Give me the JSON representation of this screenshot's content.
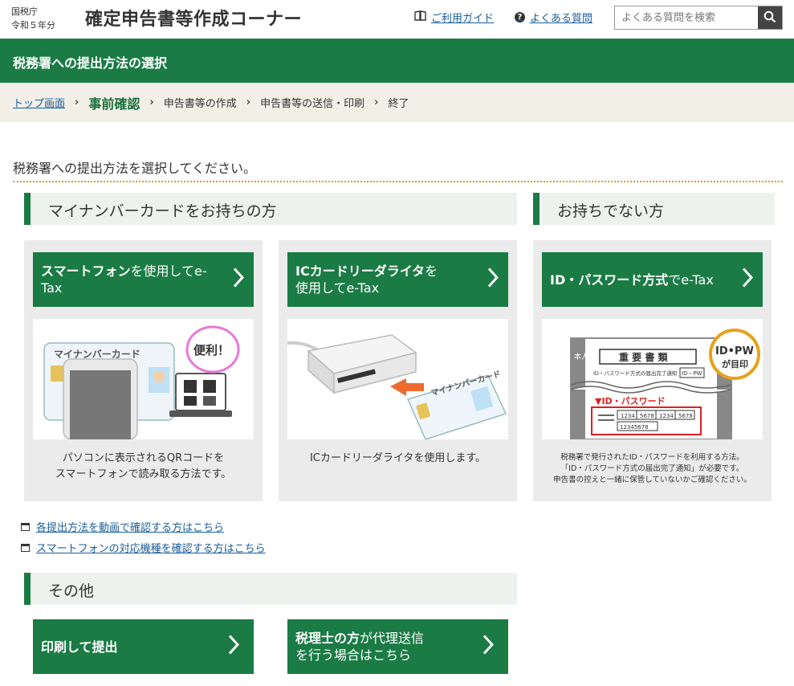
{
  "header": {
    "agency_line1": "国税庁",
    "agency_line2": "令和５年分",
    "title": "確定申告書等作成コーナー",
    "guide_link": "ご利用ガイド",
    "faq_link": "よくある質問",
    "search_placeholder": "よくある質問を検索"
  },
  "band": {
    "title": "税務署への提出方法の選択"
  },
  "breadcrumb": {
    "items": [
      "トップ画面",
      "事前確認",
      "申告書等の作成",
      "申告書等の送信・印刷",
      "終了"
    ],
    "current_index": 1
  },
  "instruction": "税務署への提出方法を選択してください。",
  "sections": {
    "mynumber": "マイナンバーカードをお持ちの方",
    "nocard": "お持ちでない方",
    "other": "その他"
  },
  "cards": [
    {
      "btn_bold": "スマートフォン",
      "btn_rest": "を使用してe-Tax",
      "desc_line1": "パソコンに表示されるQRコードを",
      "desc_line2": "スマートフォンで読み取る方法です。",
      "img_card_text": "マイナンバーカード",
      "img_bubble": "便利！"
    },
    {
      "btn_bold": "ICカードリーダライタ",
      "btn_rest": "を",
      "btn_line2": "使用してe-Tax",
      "desc_line1": "ICカードリーダライタを使用します。",
      "img_card_text": "マイナンバーカード"
    },
    {
      "btn_bold": "ID・パスワード方式",
      "btn_rest": "でe-Tax",
      "desc_line1": "税務署で発行されたID・パスワードを利用する方法。",
      "desc_line2": "「ID・パスワード方式の届出完了通知」が必要です。",
      "desc_line3": "申告書の控えと一緒に保管していないかご確認ください。",
      "img_doc_title": "重 要 書 類",
      "img_doc_sub": "ID・パスワード方式の届出完了通知",
      "img_badge_line1": "ID•PW",
      "img_badge_line2": "が目印",
      "img_pw_label": "▼ID・パスワード",
      "img_side": "本人用",
      "img_idpw": "ID・PW",
      "img_codes": [
        "1234",
        "5678",
        "1234",
        "5678"
      ],
      "img_code_long": "12345678"
    }
  ],
  "links": [
    "各提出方法を動画で確認する方はこちら",
    "スマートフォンの対応機種を確認する方はこちら"
  ],
  "bottom_buttons": [
    {
      "bold": "印刷して提出"
    },
    {
      "bold": "税理士の方",
      "rest": "が代理送信",
      "line2": "を行う場合はこちら"
    }
  ],
  "colors": {
    "primary_green": "#1b7b45",
    "link_blue": "#1a5e9a",
    "crumb_bg": "#f1efe6",
    "accent_gold": "#d4a017"
  }
}
